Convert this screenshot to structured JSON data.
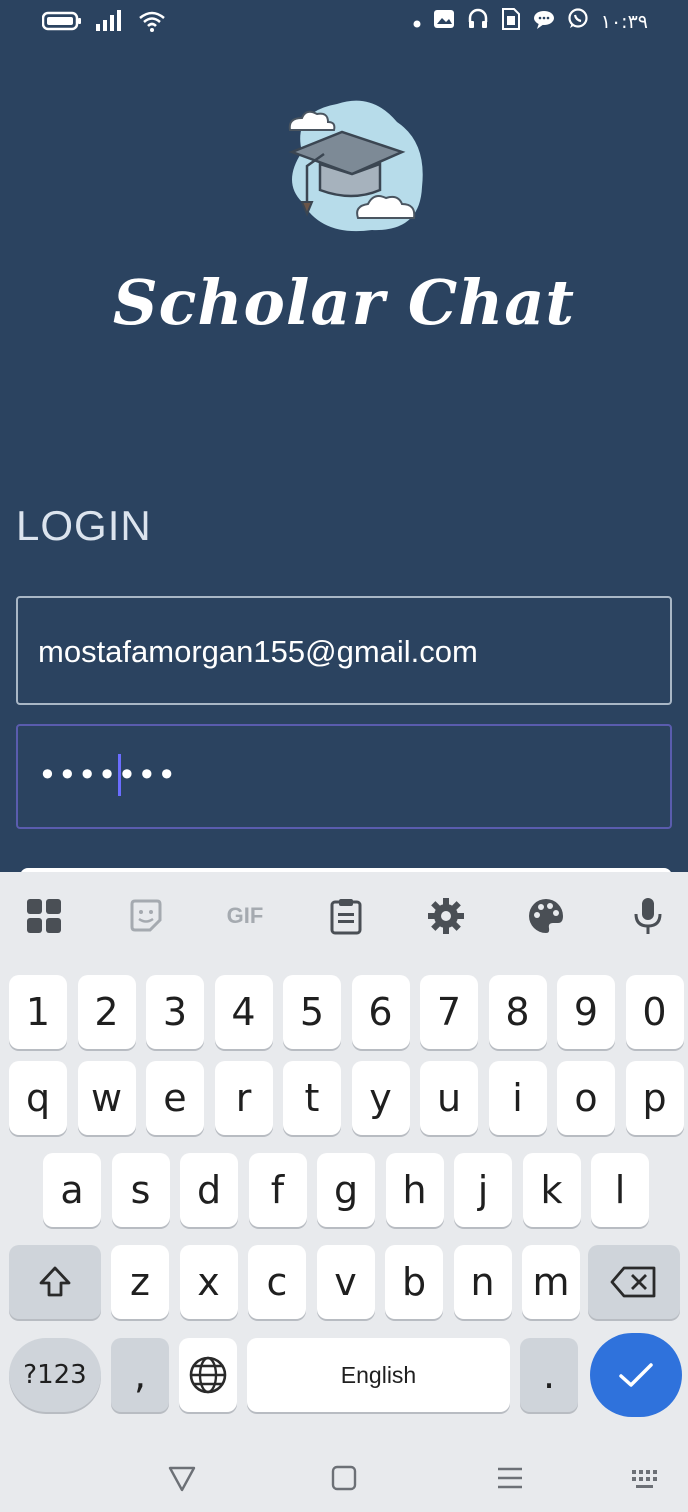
{
  "status_bar": {
    "time": "١٠:٣٩",
    "left_icons": [
      "battery-icon",
      "signal-icon",
      "wifi-icon"
    ],
    "right_icons": [
      "dot-icon",
      "gallery-icon",
      "headphones-icon",
      "sim-icon",
      "chat-bubble-icon",
      "whatsapp-icon"
    ]
  },
  "app": {
    "title": "Scholar Chat"
  },
  "login": {
    "heading": "LOGIN",
    "email_value": "mostafamorgan155@gmail.com",
    "password_value": "•••••••"
  },
  "keyboard": {
    "toolbar_icons": [
      "apps-grid-icon",
      "sticker-icon",
      "gif-icon",
      "clipboard-icon",
      "settings-gear-icon",
      "palette-icon",
      "microphone-icon"
    ],
    "gif_label": "GIF",
    "row_numbers": [
      "1",
      "2",
      "3",
      "4",
      "5",
      "6",
      "7",
      "8",
      "9",
      "0"
    ],
    "row_top": [
      "q",
      "w",
      "e",
      "r",
      "t",
      "y",
      "u",
      "i",
      "o",
      "p"
    ],
    "row_home": [
      "a",
      "s",
      "d",
      "f",
      "g",
      "h",
      "j",
      "k",
      "l"
    ],
    "row_bottom": [
      "z",
      "x",
      "c",
      "v",
      "b",
      "n",
      "m"
    ],
    "symbols_label": "?123",
    "comma_label": ",",
    "space_label": "English",
    "period_label": ".",
    "shift_icon": "shift-icon",
    "backspace_icon": "backspace-icon",
    "globe_icon": "globe-icon",
    "enter_icon": "check-icon"
  },
  "colors": {
    "background": "#2b4360",
    "field_border": "#a9b7c6",
    "focused_border": "#5a5cae",
    "enter_key": "#2f72dc",
    "keyboard_bg": "#e8eaed"
  },
  "nav_bar": {
    "icons": [
      "back-triangle-icon",
      "home-square-icon",
      "recents-lines-icon",
      "keyboard-switch-icon"
    ]
  }
}
